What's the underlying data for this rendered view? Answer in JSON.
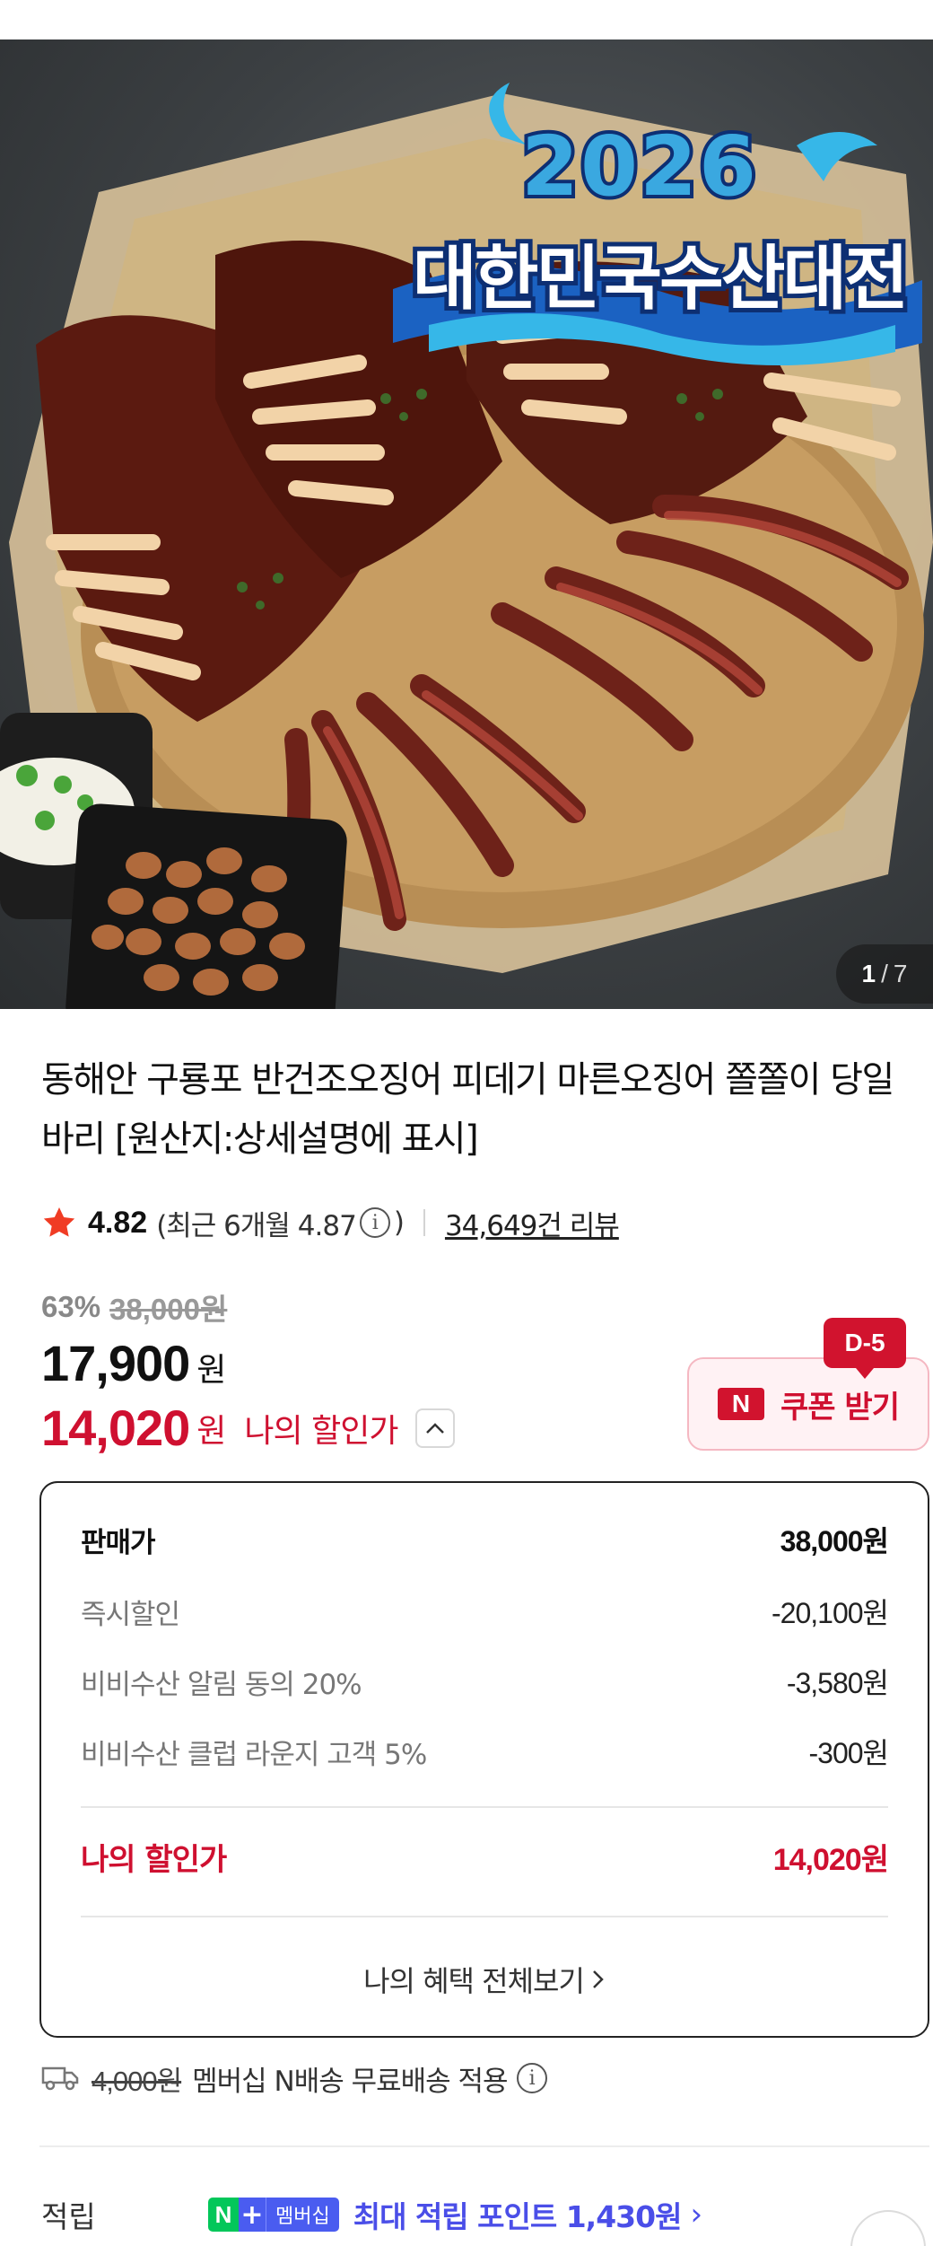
{
  "hero": {
    "badge_year": "2026",
    "badge_title": "대한민국수산대전",
    "page_current": "1",
    "page_separator": "/",
    "page_total": "7"
  },
  "product": {
    "title": "동해안 구룡포 반건조오징어 피데기 마른오징어 쫄쫄이 당일바리 [원산지:상세설명에 표시]"
  },
  "rating": {
    "score": "4.82",
    "recent_open": "(최근 6개월 4.87",
    "recent_close": ")",
    "review_count": "34,649건 리뷰",
    "star_color": "#f03c24"
  },
  "price": {
    "discount_rate": "63%",
    "original": "38,000원",
    "sale": "17,900",
    "won": "원",
    "my_price": "14,020",
    "my_label": "나의 할인가",
    "accent_color": "#cf1030"
  },
  "coupon": {
    "badge": "D-5",
    "icon_text": "N",
    "label": "쿠폰 받기"
  },
  "breakdown": {
    "rows": [
      {
        "label": "판매가",
        "value": "38,000원"
      },
      {
        "label": "즉시할인",
        "value": "-20,100원"
      },
      {
        "label": "비비수산 알림 동의 20%",
        "value": "-3,580원"
      },
      {
        "label": "비비수산 클럽 라운지 고객 5%",
        "value": "-300원"
      }
    ],
    "total_label": "나의 할인가",
    "total_value": "14,020원",
    "view_all": "나의 혜택 전체보기"
  },
  "shipping": {
    "old_fee": "4,000원",
    "text": "멤버십 N배송 무료배송 적용"
  },
  "points": {
    "label": "적립",
    "badge_n": "N",
    "badge_plus": "+",
    "badge_member": "멤버십",
    "text": "최대 적립 포인트 1,430원",
    "accent_color": "#4a4ee8"
  }
}
